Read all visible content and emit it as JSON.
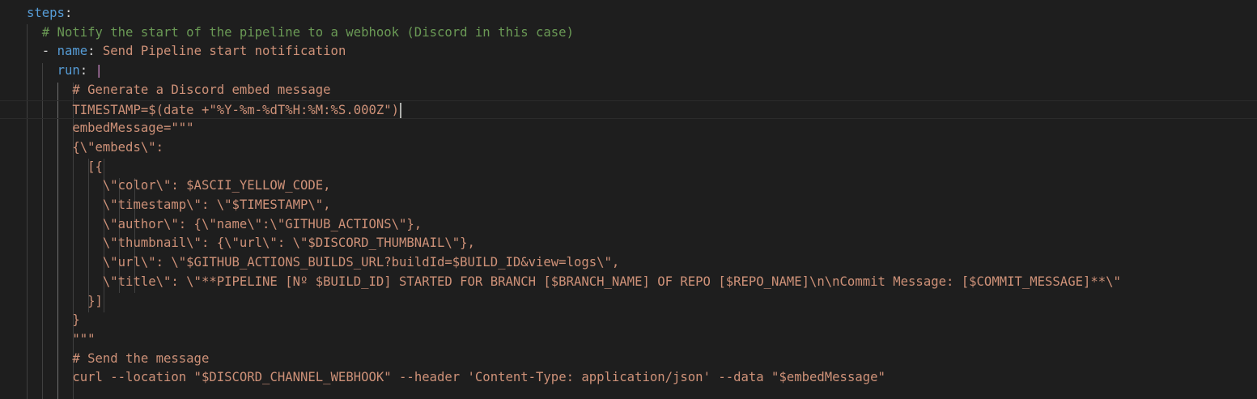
{
  "lines": [
    {
      "indent": "",
      "parts": [
        {
          "t": "steps",
          "c": "k"
        },
        {
          "t": ":",
          "c": "p"
        }
      ]
    },
    {
      "indent": "  ",
      "parts": [
        {
          "t": "# Notify the start of the pipeline to a webhook (Discord in this case)",
          "c": "c"
        }
      ]
    },
    {
      "indent": "  ",
      "parts": [
        {
          "t": "- ",
          "c": "p"
        },
        {
          "t": "name",
          "c": "k"
        },
        {
          "t": ": ",
          "c": "p"
        },
        {
          "t": "Send Pipeline start notification",
          "c": "s"
        }
      ]
    },
    {
      "indent": "    ",
      "parts": [
        {
          "t": "run",
          "c": "k"
        },
        {
          "t": ": ",
          "c": "p"
        },
        {
          "t": "|",
          "c": "bar"
        }
      ]
    },
    {
      "indent": "      ",
      "parts": [
        {
          "t": "# Generate a Discord embed message",
          "c": "s"
        }
      ]
    },
    {
      "indent": "      ",
      "parts": [
        {
          "t": "TIMESTAMP=$(date +\"%Y-%m-%dT%H:%M:%S.000Z\")",
          "c": "s"
        }
      ],
      "cursor": true
    },
    {
      "indent": "      ",
      "parts": [
        {
          "t": "embedMessage=\"\"\"",
          "c": "s"
        }
      ]
    },
    {
      "indent": "      ",
      "parts": [
        {
          "t": "{\\\"embeds\\\":",
          "c": "s"
        }
      ]
    },
    {
      "indent": "        ",
      "parts": [
        {
          "t": "[{",
          "c": "s"
        }
      ]
    },
    {
      "indent": "          ",
      "parts": [
        {
          "t": "\\\"color\\\": $ASCII_YELLOW_CODE,",
          "c": "s"
        }
      ]
    },
    {
      "indent": "          ",
      "parts": [
        {
          "t": "\\\"timestamp\\\": \\\"$TIMESTAMP\\\",",
          "c": "s"
        }
      ]
    },
    {
      "indent": "          ",
      "parts": [
        {
          "t": "\\\"author\\\": {\\\"name\\\":\\\"GITHUB_ACTIONS\\\"},",
          "c": "s"
        }
      ]
    },
    {
      "indent": "          ",
      "parts": [
        {
          "t": "\\\"thumbnail\\\": {\\\"url\\\": \\\"$DISCORD_THUMBNAIL\\\"},",
          "c": "s"
        }
      ]
    },
    {
      "indent": "          ",
      "parts": [
        {
          "t": "\\\"url\\\": \\\"$GITHUB_ACTIONS_BUILDS_URL?buildId=$BUILD_ID&view=logs\\\",",
          "c": "s"
        }
      ]
    },
    {
      "indent": "          ",
      "parts": [
        {
          "t": "\\\"title\\\": \\\"**PIPELINE [Nº $BUILD_ID] STARTED FOR BRANCH [$BRANCH_NAME] OF REPO [$REPO_NAME]\\n\\nCommit Message: [$COMMIT_MESSAGE]**\\\"",
          "c": "s"
        }
      ]
    },
    {
      "indent": "        ",
      "parts": [
        {
          "t": "}]",
          "c": "s"
        }
      ]
    },
    {
      "indent": "      ",
      "parts": [
        {
          "t": "}",
          "c": "s"
        }
      ]
    },
    {
      "indent": "      ",
      "parts": [
        {
          "t": "\"\"\"",
          "c": "s"
        }
      ]
    },
    {
      "indent": "      ",
      "parts": [
        {
          "t": "# Send the message",
          "c": "s"
        }
      ]
    },
    {
      "indent": "      ",
      "parts": [
        {
          "t": "curl --location \"$DISCORD_CHANNEL_WEBHOOK\" --header 'Content-Type: application/json' --data \"$embedMessage\"",
          "c": "s"
        }
      ]
    }
  ],
  "colors": {
    "background": "#1e1e1e",
    "key": "#569cd6",
    "comment": "#6a9955",
    "punctuation": "#d4d4d4",
    "string": "#ce9178",
    "block_indicator": "#c586c0"
  }
}
